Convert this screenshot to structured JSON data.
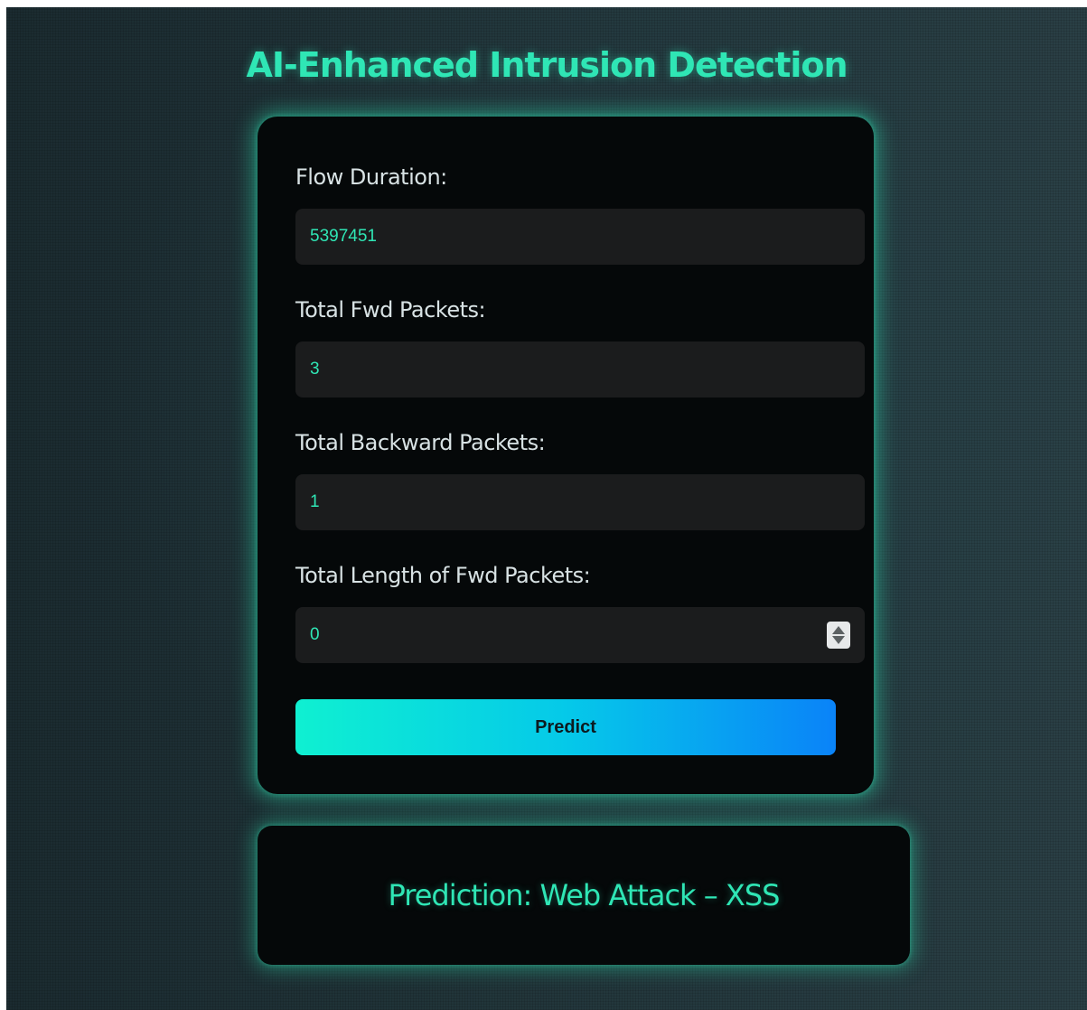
{
  "header": {
    "title": "AI-Enhanced Intrusion Detection"
  },
  "form": {
    "fields": [
      {
        "label": "Flow Duration:",
        "value": "5397451"
      },
      {
        "label": "Total Fwd Packets:",
        "value": "3"
      },
      {
        "label": "Total Backward Packets:",
        "value": "1"
      },
      {
        "label": "Total Length of Fwd Packets:",
        "value": "0"
      }
    ],
    "submit_label": "Predict"
  },
  "result": {
    "text": "Prediction: Web Attack – XSS"
  },
  "colors": {
    "accent": "#2fe6b5",
    "card_bg": "#050809",
    "input_bg": "#1b1c1d",
    "button_gradient_start": "#0ff0d1",
    "button_gradient_end": "#0a83f8"
  }
}
